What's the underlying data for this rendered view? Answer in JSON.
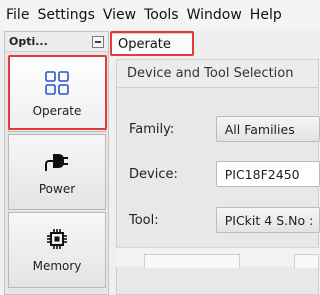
{
  "menubar": {
    "items": [
      "File",
      "Settings",
      "View",
      "Tools",
      "Window",
      "Help"
    ]
  },
  "left_panel": {
    "header": "Opti...",
    "buttons": [
      {
        "label": "Operate",
        "icon": "grid-icon"
      },
      {
        "label": "Power",
        "icon": "power-plug-icon"
      },
      {
        "label": "Memory",
        "icon": "chip-icon"
      }
    ]
  },
  "right_panel": {
    "tab_label": "Operate",
    "group_title": "Device and Tool Selection",
    "fields": {
      "family_label": "Family:",
      "family_value": "All Families",
      "device_label": "Device:",
      "device_value": "PIC18F2450",
      "tool_label": "Tool:",
      "tool_value": "PICkit 4 S.No :"
    }
  },
  "colors": {
    "highlight": "#e23b3b",
    "icon_blue": "#2a55c7"
  }
}
